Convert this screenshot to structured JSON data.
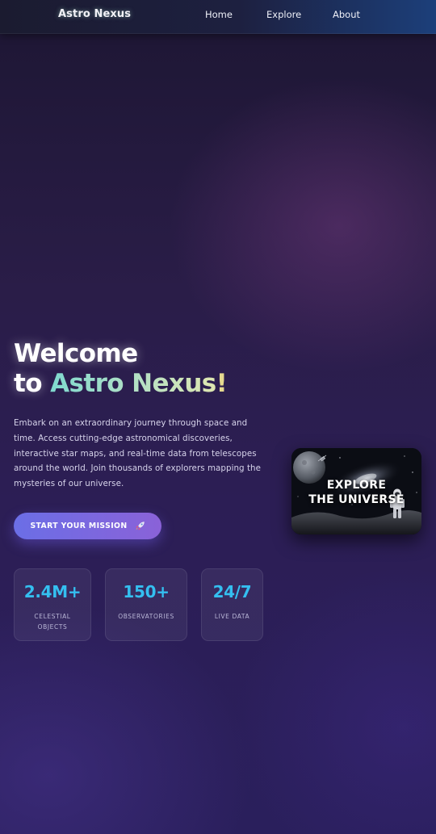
{
  "nav": {
    "brand": "Astro Nexus",
    "links": [
      "Home",
      "Explore",
      "About"
    ]
  },
  "hero": {
    "title_line1": "Welcome",
    "title_line2_prefix": "to ",
    "title_highlight": "Astro Nexus",
    "title_suffix": "!",
    "description": "Embark on an extraordinary journey through space and time. Access cutting-edge astronomical discoveries, interactive star maps, and real-time data from telescopes around the world. Join thousands of explorers mapping the mysteries of our universe.",
    "cta_label": "START YOUR MISSION",
    "cta_icon": "rocket-icon"
  },
  "stats": [
    {
      "value": "2.4M+",
      "label": "CELESTIAL OBJECTS"
    },
    {
      "value": "150+",
      "label": "OBSERVATORIES"
    },
    {
      "value": "24/7",
      "label": "LIVE DATA"
    }
  ],
  "explore_card": {
    "line1": "EXPLORE",
    "line2": "THE UNIVERSE"
  },
  "colors": {
    "accent_cyan": "#34bff0",
    "cta_start": "#6b6ee6",
    "cta_end": "#8a62d8",
    "highlight_start": "#7fd9cf",
    "highlight_end": "#dfe7b0"
  }
}
